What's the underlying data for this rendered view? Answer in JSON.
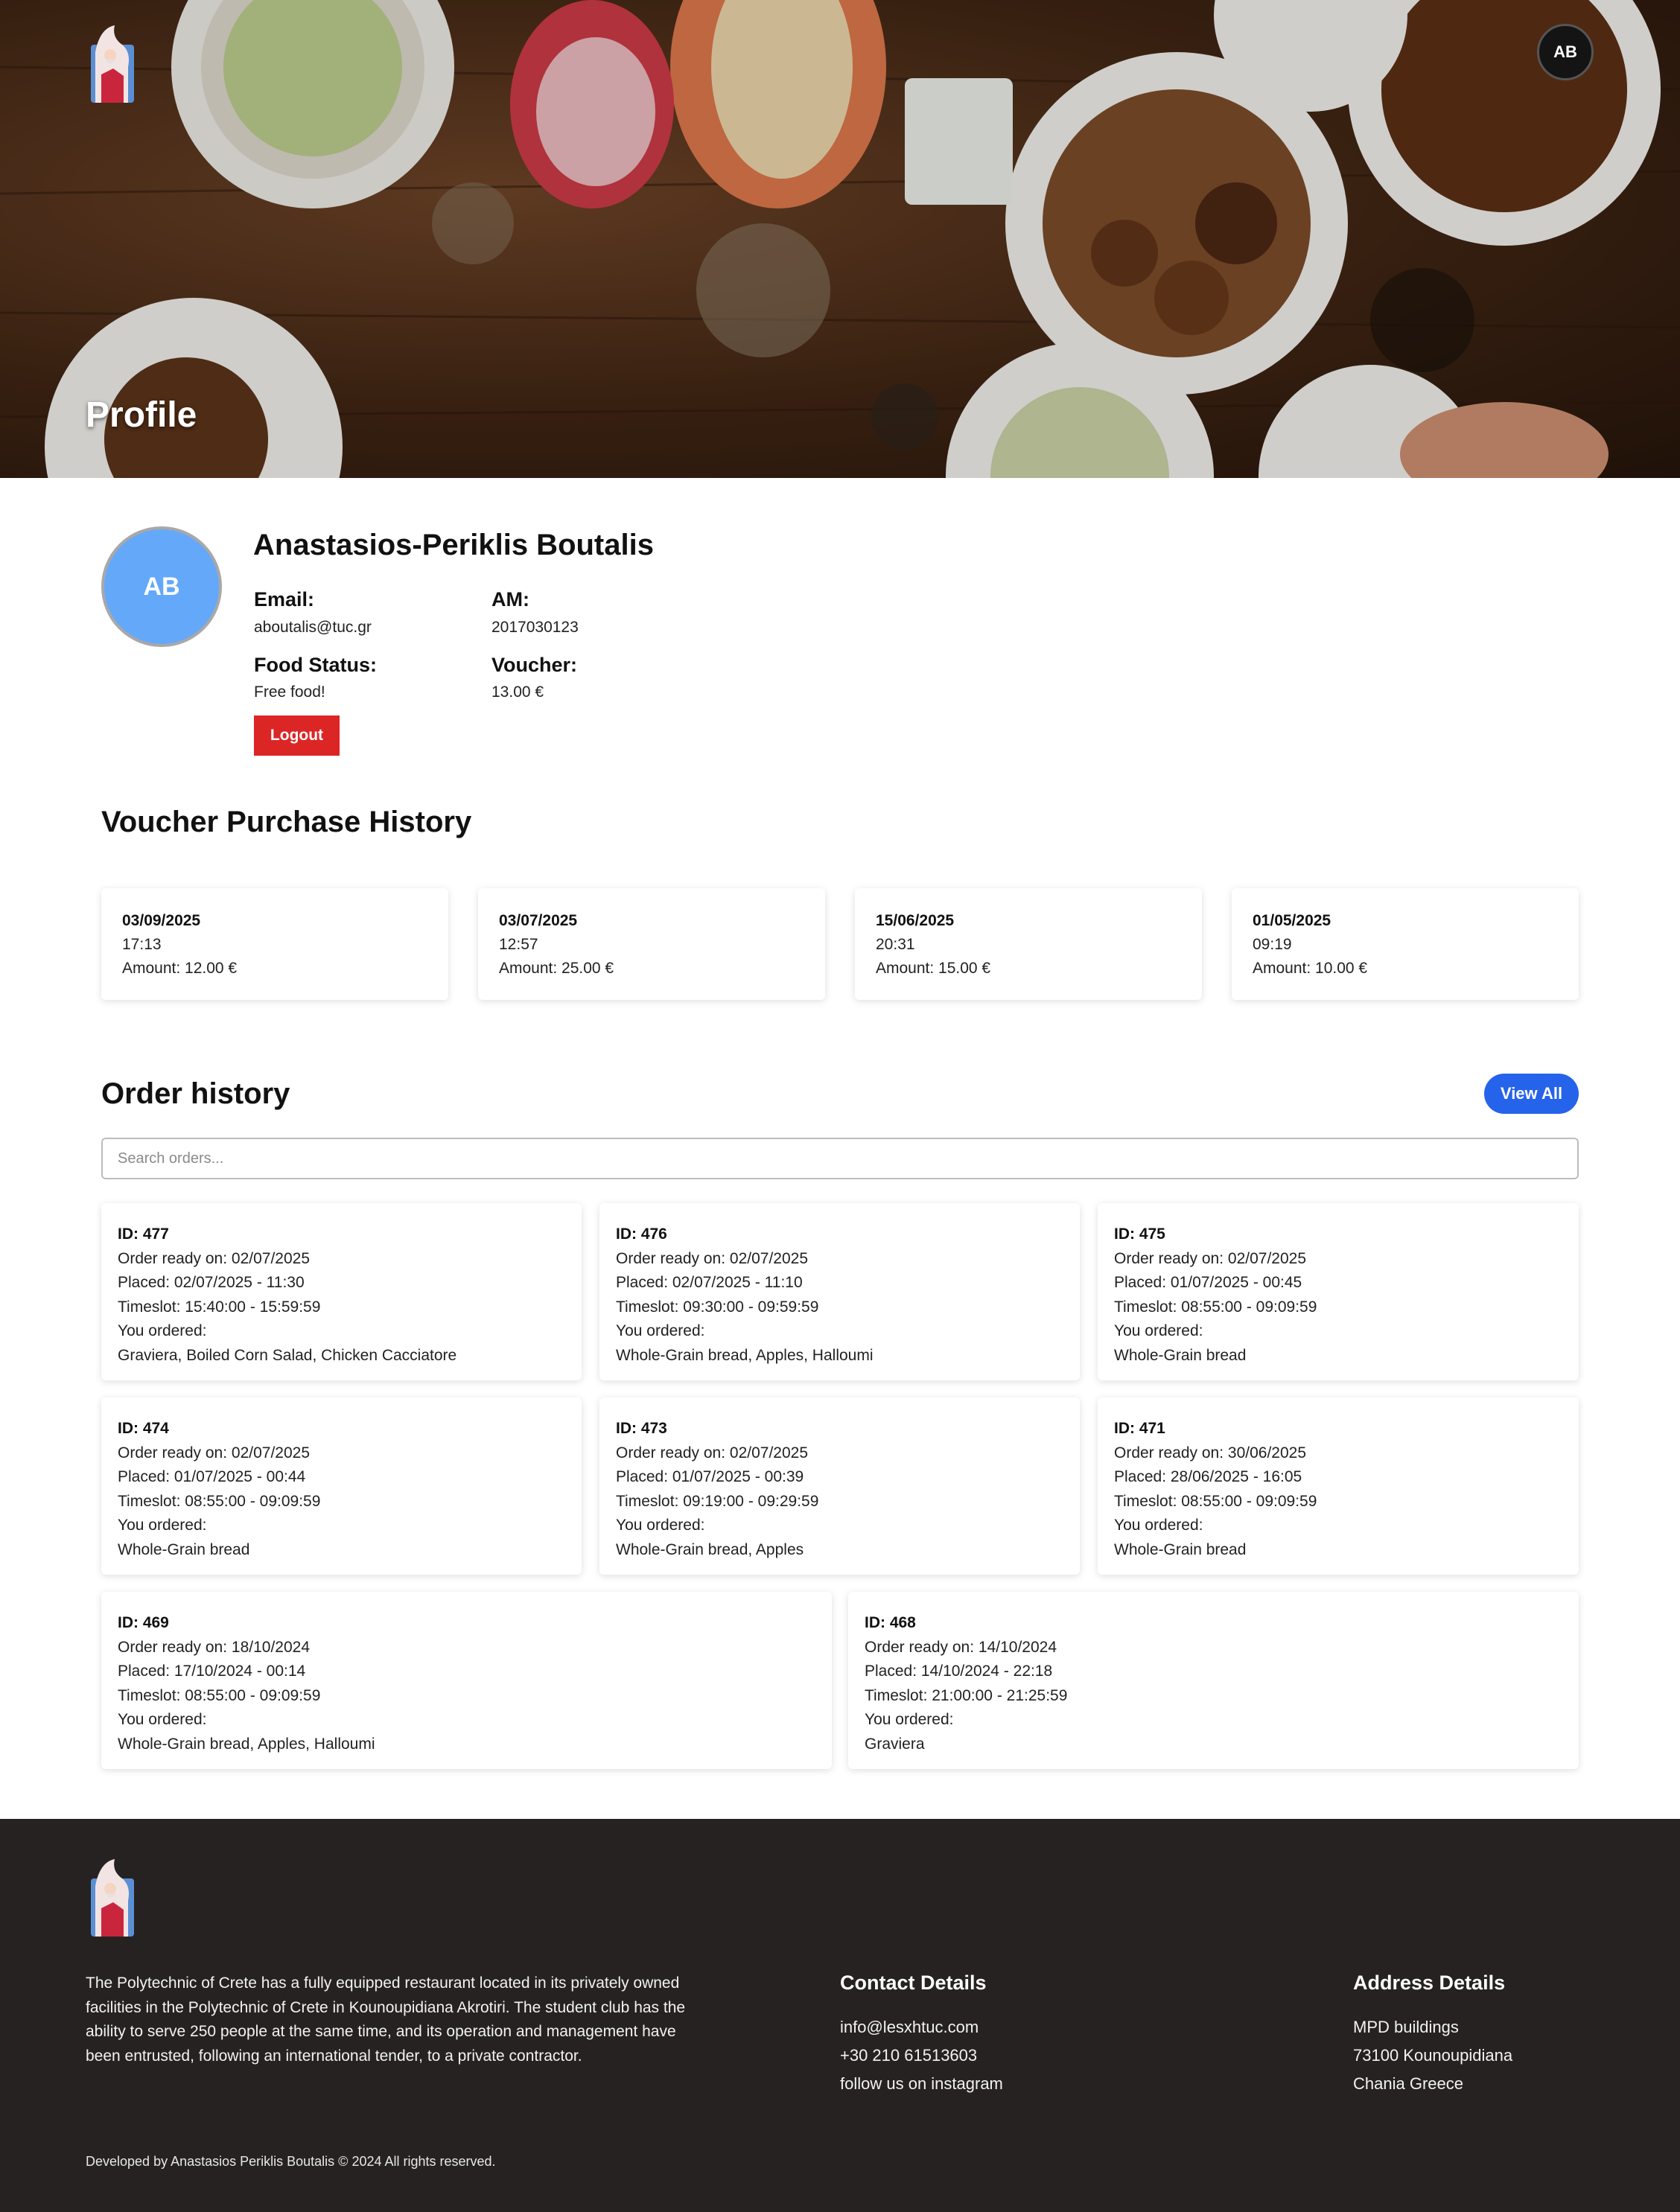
{
  "header": {
    "page_title": "Profile",
    "avatar_initials": "AB"
  },
  "profile": {
    "avatar_initials": "AB",
    "name": "Anastasios-Periklis Boutalis",
    "email_label": "Email:",
    "email": "aboutalis@tuc.gr",
    "am_label": "AM:",
    "am": "2017030123",
    "food_status_label": "Food Status:",
    "food_status": "Free food!",
    "voucher_label": "Voucher:",
    "voucher": "13.00 €",
    "logout_label": "Logout"
  },
  "vouchers": {
    "title": "Voucher Purchase History",
    "items": [
      {
        "date": "03/09/2025",
        "time": "17:13",
        "amount": "Amount: 12.00 €"
      },
      {
        "date": "03/07/2025",
        "time": "12:57",
        "amount": "Amount: 25.00 €"
      },
      {
        "date": "15/06/2025",
        "time": "20:31",
        "amount": "Amount: 15.00 €"
      },
      {
        "date": "01/05/2025",
        "time": "09:19",
        "amount": "Amount: 10.00 €"
      }
    ]
  },
  "orders": {
    "title": "Order history",
    "view_all_label": "View All",
    "search_placeholder": "Search orders...",
    "items": [
      {
        "id": "ID: 477",
        "ready": "Order ready on: 02/07/2025",
        "placed": "Placed: 02/07/2025 - 11:30",
        "timeslot": "Timeslot: 15:40:00 - 15:59:59",
        "ordered_label": "You ordered:",
        "items": "Graviera, Boiled Corn Salad, Chicken Cacciatore"
      },
      {
        "id": "ID: 476",
        "ready": "Order ready on: 02/07/2025",
        "placed": "Placed: 02/07/2025 - 11:10",
        "timeslot": "Timeslot: 09:30:00 - 09:59:59",
        "ordered_label": "You ordered:",
        "items": "Whole-Grain bread, Apples, Halloumi"
      },
      {
        "id": "ID: 475",
        "ready": "Order ready on: 02/07/2025",
        "placed": "Placed: 01/07/2025 - 00:45",
        "timeslot": "Timeslot: 08:55:00 - 09:09:59",
        "ordered_label": "You ordered:",
        "items": "Whole-Grain bread"
      },
      {
        "id": "ID: 474",
        "ready": "Order ready on: 02/07/2025",
        "placed": "Placed: 01/07/2025 - 00:44",
        "timeslot": "Timeslot: 08:55:00 - 09:09:59",
        "ordered_label": "You ordered:",
        "items": "Whole-Grain bread"
      },
      {
        "id": "ID: 473",
        "ready": "Order ready on: 02/07/2025",
        "placed": "Placed: 01/07/2025 - 00:39",
        "timeslot": "Timeslot: 09:19:00 - 09:29:59",
        "ordered_label": "You ordered:",
        "items": "Whole-Grain bread, Apples"
      },
      {
        "id": "ID: 471",
        "ready": "Order ready on: 30/06/2025",
        "placed": "Placed: 28/06/2025 - 16:05",
        "timeslot": "Timeslot: 08:55:00 - 09:09:59",
        "ordered_label": "You ordered:",
        "items": "Whole-Grain bread"
      },
      {
        "id": "ID: 469",
        "ready": "Order ready on: 18/10/2024",
        "placed": "Placed: 17/10/2024 - 00:14",
        "timeslot": "Timeslot: 08:55:00 - 09:09:59",
        "ordered_label": "You ordered:",
        "items": "Whole-Grain bread, Apples, Halloumi"
      },
      {
        "id": "ID: 468",
        "ready": "Order ready on: 14/10/2024",
        "placed": "Placed: 14/10/2024 - 22:18",
        "timeslot": "Timeslot: 21:00:00 - 21:25:59",
        "ordered_label": "You ordered:",
        "items": "Graviera"
      }
    ]
  },
  "footer": {
    "about": "The Polytechnic of Crete has a fully equipped restaurant located in its privately owned facilities in the Polytechnic of Crete in Kounoupidiana Akrotiri. The student club has the ability to serve 250 people at the same time, and its operation and management have been entrusted, following an international tender, to a private contractor.",
    "contact_title": "Contact Details",
    "contact_email": "info@lesxhtuc.com",
    "contact_phone": "+30 210 61513603",
    "contact_instagram": "follow us on instagram",
    "address_title": "Address Details",
    "address_line1": "MPD buildings",
    "address_line2": "73100 Kounoupidiana",
    "address_line3": "Chania Greece",
    "copyright": "Developed by Anastasios Periklis Boutalis © 2024 All rights reserved."
  },
  "colors": {
    "logout": "#dc2626",
    "view_all": "#2563eb",
    "avatar": "#64a8fa",
    "footer_bg": "#262222"
  },
  "icons": {
    "logo": "university-mascot-logo",
    "avatar": "user-initials-avatar"
  }
}
